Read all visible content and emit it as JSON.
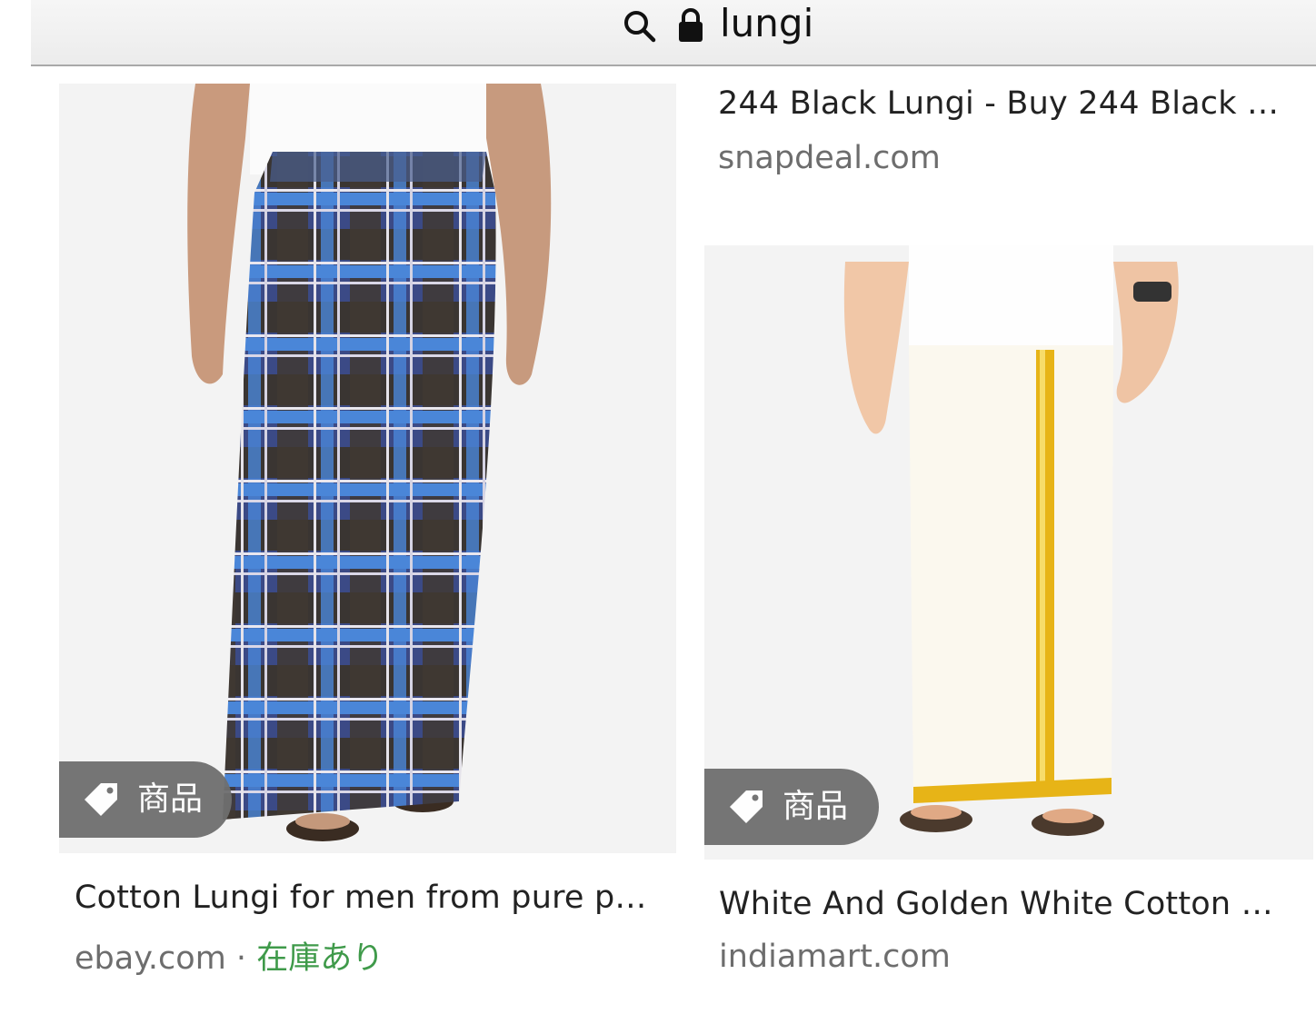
{
  "url_bar": {
    "query": "lungi",
    "search_icon": "search-icon",
    "lock_icon": "lock-icon"
  },
  "results": [
    {
      "title": "244 Black Lungi - Buy 244 Black …",
      "source": "snapdeal.com"
    },
    {
      "title": "Cotton Lungi for men from pure p…",
      "source": "ebay.com",
      "separator": " · ",
      "availability": "在庫あり",
      "badge_label": "商品",
      "badge_icon": "tag-icon"
    },
    {
      "title": "White And Golden White Cotton …",
      "source": "indiamart.com",
      "badge_label": "商品",
      "badge_icon": "tag-icon"
    }
  ],
  "colors": {
    "availability": "#3f9a4a",
    "badge_bg": "#6f6f6f",
    "source_text": "#6d6d6d"
  }
}
